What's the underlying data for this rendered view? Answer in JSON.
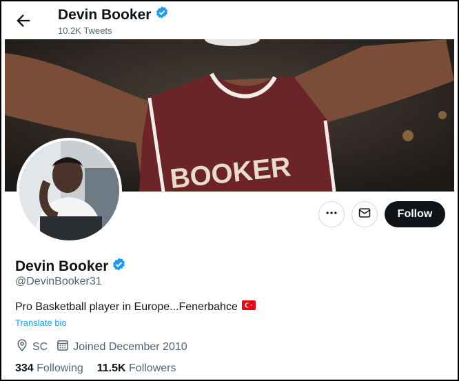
{
  "header": {
    "back_icon": "arrow-left-icon",
    "name": "Devin Booker",
    "verified_icon": "verified-badge-icon",
    "tweet_count": "10.2K Tweets"
  },
  "banner": {
    "jersey_text": "BOOKER"
  },
  "actions": {
    "more_icon": "more-horizontal-icon",
    "message_icon": "envelope-icon",
    "follow_label": "Follow"
  },
  "profile": {
    "name": "Devin Booker",
    "handle": "@DevinBooker31",
    "bio": "Pro Basketball player in Europe...Fenerbahce",
    "bio_flag_icon": "turkey-flag-icon",
    "translate_label": "Translate bio",
    "location": "SC",
    "location_icon": "location-pin-icon",
    "joined": "Joined December 2010",
    "joined_icon": "calendar-icon"
  },
  "stats": {
    "following_count": "334",
    "following_label": "Following",
    "followers_count": "11.5K",
    "followers_label": "Followers"
  },
  "colors": {
    "accent": "#1d9bf0",
    "follow_button": "#0f1419",
    "secondary_text": "#536471",
    "jersey": "#7a2a2e"
  }
}
